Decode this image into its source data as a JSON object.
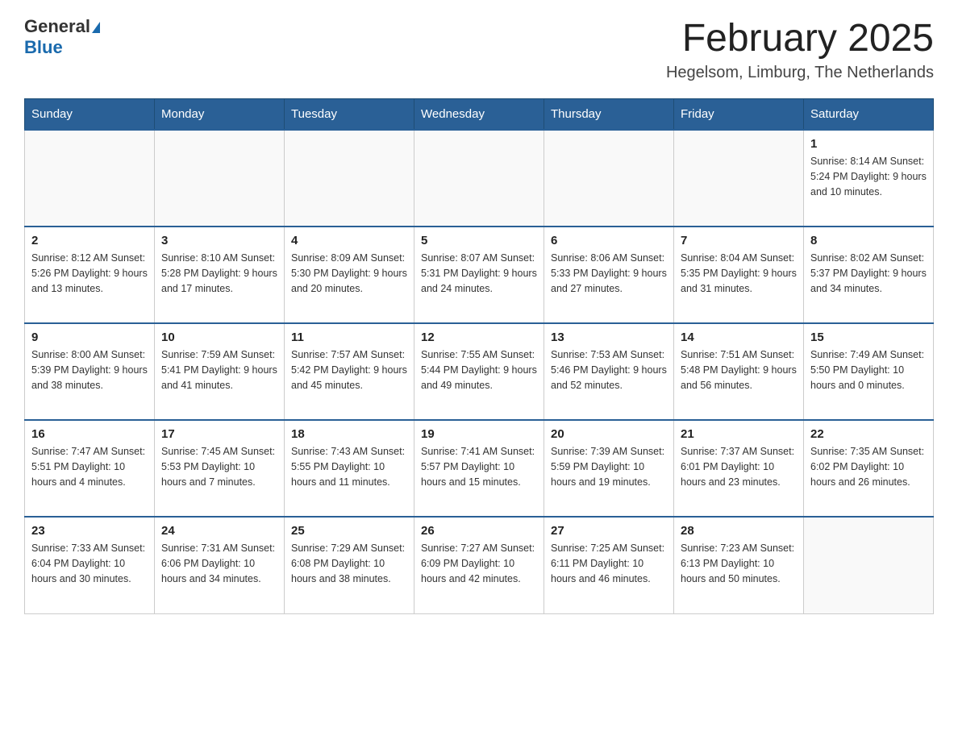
{
  "header": {
    "logo_general": "General",
    "logo_blue": "Blue",
    "month_title": "February 2025",
    "location": "Hegelsom, Limburg, The Netherlands"
  },
  "weekdays": [
    "Sunday",
    "Monday",
    "Tuesday",
    "Wednesday",
    "Thursday",
    "Friday",
    "Saturday"
  ],
  "weeks": [
    [
      {
        "day": "",
        "info": ""
      },
      {
        "day": "",
        "info": ""
      },
      {
        "day": "",
        "info": ""
      },
      {
        "day": "",
        "info": ""
      },
      {
        "day": "",
        "info": ""
      },
      {
        "day": "",
        "info": ""
      },
      {
        "day": "1",
        "info": "Sunrise: 8:14 AM\nSunset: 5:24 PM\nDaylight: 9 hours and 10 minutes."
      }
    ],
    [
      {
        "day": "2",
        "info": "Sunrise: 8:12 AM\nSunset: 5:26 PM\nDaylight: 9 hours and 13 minutes."
      },
      {
        "day": "3",
        "info": "Sunrise: 8:10 AM\nSunset: 5:28 PM\nDaylight: 9 hours and 17 minutes."
      },
      {
        "day": "4",
        "info": "Sunrise: 8:09 AM\nSunset: 5:30 PM\nDaylight: 9 hours and 20 minutes."
      },
      {
        "day": "5",
        "info": "Sunrise: 8:07 AM\nSunset: 5:31 PM\nDaylight: 9 hours and 24 minutes."
      },
      {
        "day": "6",
        "info": "Sunrise: 8:06 AM\nSunset: 5:33 PM\nDaylight: 9 hours and 27 minutes."
      },
      {
        "day": "7",
        "info": "Sunrise: 8:04 AM\nSunset: 5:35 PM\nDaylight: 9 hours and 31 minutes."
      },
      {
        "day": "8",
        "info": "Sunrise: 8:02 AM\nSunset: 5:37 PM\nDaylight: 9 hours and 34 minutes."
      }
    ],
    [
      {
        "day": "9",
        "info": "Sunrise: 8:00 AM\nSunset: 5:39 PM\nDaylight: 9 hours and 38 minutes."
      },
      {
        "day": "10",
        "info": "Sunrise: 7:59 AM\nSunset: 5:41 PM\nDaylight: 9 hours and 41 minutes."
      },
      {
        "day": "11",
        "info": "Sunrise: 7:57 AM\nSunset: 5:42 PM\nDaylight: 9 hours and 45 minutes."
      },
      {
        "day": "12",
        "info": "Sunrise: 7:55 AM\nSunset: 5:44 PM\nDaylight: 9 hours and 49 minutes."
      },
      {
        "day": "13",
        "info": "Sunrise: 7:53 AM\nSunset: 5:46 PM\nDaylight: 9 hours and 52 minutes."
      },
      {
        "day": "14",
        "info": "Sunrise: 7:51 AM\nSunset: 5:48 PM\nDaylight: 9 hours and 56 minutes."
      },
      {
        "day": "15",
        "info": "Sunrise: 7:49 AM\nSunset: 5:50 PM\nDaylight: 10 hours and 0 minutes."
      }
    ],
    [
      {
        "day": "16",
        "info": "Sunrise: 7:47 AM\nSunset: 5:51 PM\nDaylight: 10 hours and 4 minutes."
      },
      {
        "day": "17",
        "info": "Sunrise: 7:45 AM\nSunset: 5:53 PM\nDaylight: 10 hours and 7 minutes."
      },
      {
        "day": "18",
        "info": "Sunrise: 7:43 AM\nSunset: 5:55 PM\nDaylight: 10 hours and 11 minutes."
      },
      {
        "day": "19",
        "info": "Sunrise: 7:41 AM\nSunset: 5:57 PM\nDaylight: 10 hours and 15 minutes."
      },
      {
        "day": "20",
        "info": "Sunrise: 7:39 AM\nSunset: 5:59 PM\nDaylight: 10 hours and 19 minutes."
      },
      {
        "day": "21",
        "info": "Sunrise: 7:37 AM\nSunset: 6:01 PM\nDaylight: 10 hours and 23 minutes."
      },
      {
        "day": "22",
        "info": "Sunrise: 7:35 AM\nSunset: 6:02 PM\nDaylight: 10 hours and 26 minutes."
      }
    ],
    [
      {
        "day": "23",
        "info": "Sunrise: 7:33 AM\nSunset: 6:04 PM\nDaylight: 10 hours and 30 minutes."
      },
      {
        "day": "24",
        "info": "Sunrise: 7:31 AM\nSunset: 6:06 PM\nDaylight: 10 hours and 34 minutes."
      },
      {
        "day": "25",
        "info": "Sunrise: 7:29 AM\nSunset: 6:08 PM\nDaylight: 10 hours and 38 minutes."
      },
      {
        "day": "26",
        "info": "Sunrise: 7:27 AM\nSunset: 6:09 PM\nDaylight: 10 hours and 42 minutes."
      },
      {
        "day": "27",
        "info": "Sunrise: 7:25 AM\nSunset: 6:11 PM\nDaylight: 10 hours and 46 minutes."
      },
      {
        "day": "28",
        "info": "Sunrise: 7:23 AM\nSunset: 6:13 PM\nDaylight: 10 hours and 50 minutes."
      },
      {
        "day": "",
        "info": ""
      }
    ]
  ]
}
